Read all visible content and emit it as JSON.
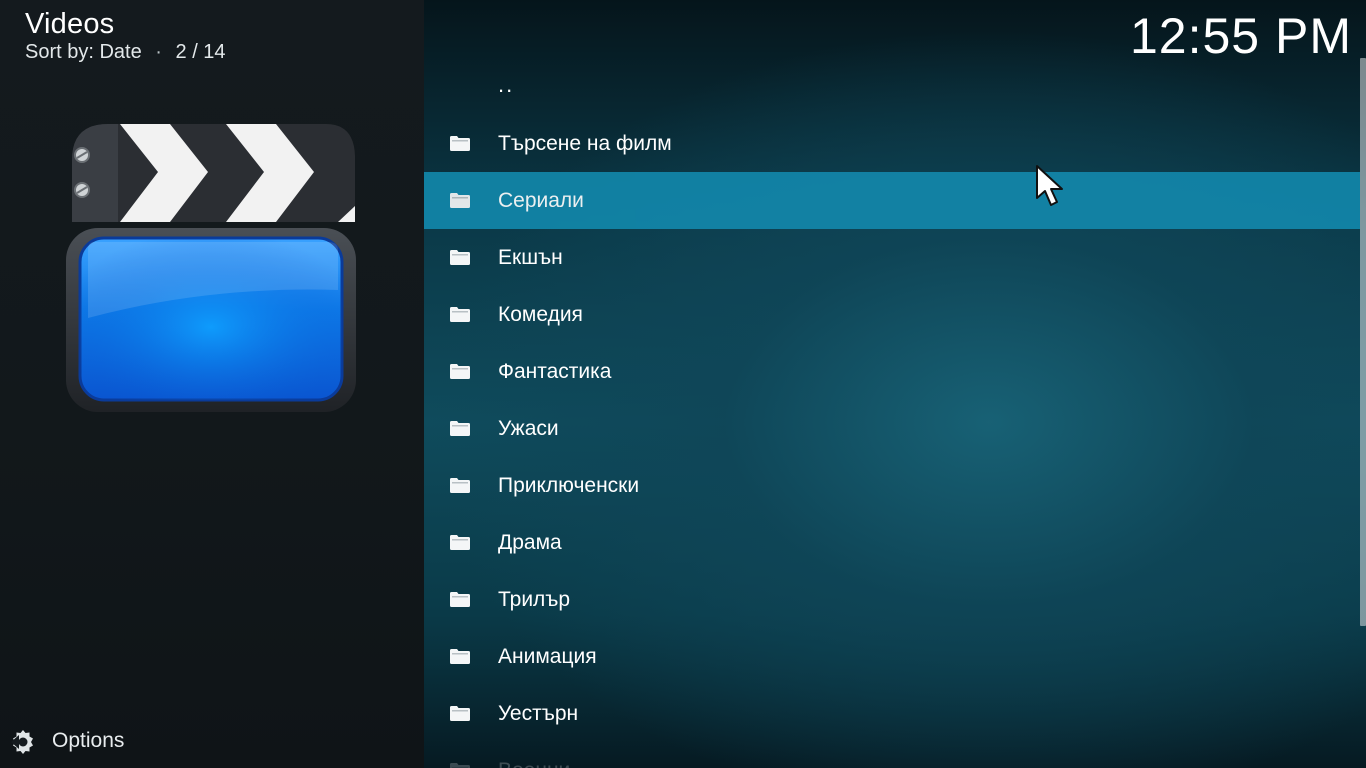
{
  "header": {
    "title": "Videos",
    "sort_label": "Sort by: Date",
    "separator": "·",
    "position": "2 / 14"
  },
  "thumbnail": {
    "icon": "clapperboard-icon"
  },
  "options": {
    "label": "Options",
    "icon": "options-gear-icon"
  },
  "clock": "12:55 PM",
  "list": {
    "up": "..",
    "items": [
      {
        "label": "Търсене на филм",
        "icon": "folder-icon"
      },
      {
        "label": "Сериали",
        "icon": "folder-icon",
        "selected": true
      },
      {
        "label": "Екшън",
        "icon": "folder-icon"
      },
      {
        "label": "Комедия",
        "icon": "folder-icon"
      },
      {
        "label": "Фантастика",
        "icon": "folder-icon"
      },
      {
        "label": "Ужаси",
        "icon": "folder-icon"
      },
      {
        "label": "Приключенски",
        "icon": "folder-icon"
      },
      {
        "label": "Драма",
        "icon": "folder-icon"
      },
      {
        "label": "Трилър",
        "icon": "folder-icon"
      },
      {
        "label": "Анимация",
        "icon": "folder-icon"
      },
      {
        "label": "Уестърн",
        "icon": "folder-icon"
      },
      {
        "label": "Военни",
        "icon": "folder-icon"
      }
    ]
  },
  "colors": {
    "selection": "#1287aa",
    "left_panel": "#141a1e",
    "right_panel": "#0f4b5c"
  }
}
